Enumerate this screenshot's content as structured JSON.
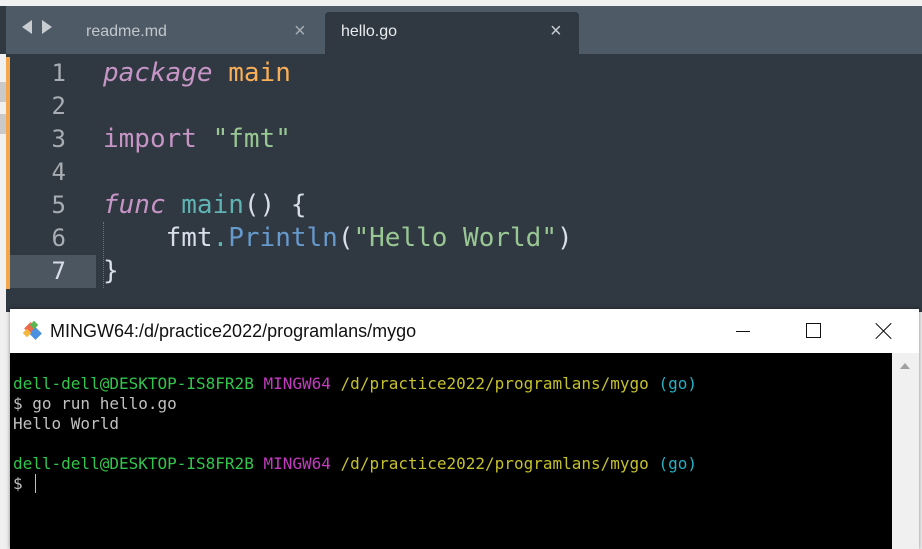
{
  "editor": {
    "tabs": [
      {
        "label": "readme.md",
        "close": "×"
      },
      {
        "label": "hello.go",
        "close": "×"
      }
    ],
    "line_numbers": [
      "1",
      "2",
      "3",
      "4",
      "5",
      "6",
      "7"
    ],
    "code": {
      "l1_kw": "package",
      "l1_name": "main",
      "l3_kw": "import",
      "l3_str": "\"fmt\"",
      "l5_kw": "func",
      "l5_fn": "main",
      "l5_rest": "() {",
      "l6_indent": "    ",
      "l6_pkg": "fmt",
      "l6_dot": ".",
      "l6_call": "Println",
      "l6_open": "(",
      "l6_str": "\"Hello World\"",
      "l6_close": ")",
      "l7": "}"
    },
    "colors": {
      "background": "#303841",
      "keyword": "#c695c6",
      "identifier": "#f9ae58",
      "string": "#99c794",
      "function": "#5fb3b3",
      "modified_marker": "#f5a64a"
    }
  },
  "terminal": {
    "title": "MINGW64:/d/practice2022/programlans/mygo",
    "prompt1": {
      "user": "dell-dell@DESKTOP-IS8FR2B",
      "system": "MINGW64",
      "path": "/d/practice2022/programlans/mygo",
      "branch": "(go)"
    },
    "command": "$ go run hello.go",
    "output": "Hello World",
    "prompt2": {
      "user": "dell-dell@DESKTOP-IS8FR2B",
      "system": "MINGW64",
      "path": "/d/practice2022/programlans/mygo",
      "branch": "(go)"
    },
    "current_input": "$ ",
    "icons": {
      "app": "git-bash-icon",
      "minimize": "minimize-icon",
      "maximize": "maximize-icon",
      "close": "close-icon"
    }
  }
}
